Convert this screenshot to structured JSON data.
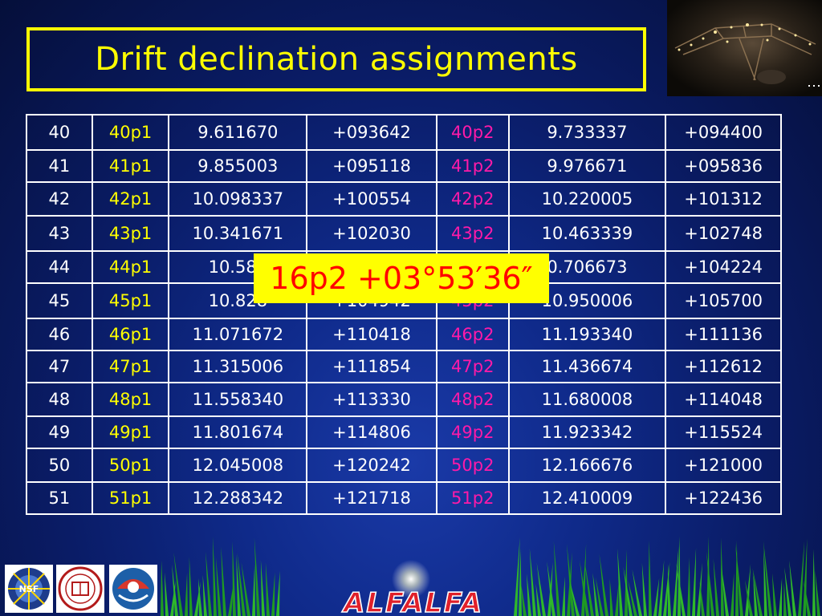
{
  "title": "Drift declination assignments",
  "popup": "16p2 +03°53′36″",
  "rows": [
    [
      "40",
      "40p1",
      "9.611670",
      "+093642",
      "40p2",
      "9.733337",
      "+094400"
    ],
    [
      "41",
      "41p1",
      "9.855003",
      "+095118",
      "41p2",
      "9.976671",
      "+095836"
    ],
    [
      "42",
      "42p1",
      "10.098337",
      "+100554",
      "42p2",
      "10.220005",
      "+101312"
    ],
    [
      "43",
      "43p1",
      "10.341671",
      "+102030",
      "43p2",
      "10.463339",
      "+102748"
    ],
    [
      "44",
      "44p1",
      "10.585",
      "",
      "",
      "0.706673",
      "+104224"
    ],
    [
      "45",
      "45p1",
      "10.828",
      "+104942",
      "45p2",
      "10.950006",
      "+105700"
    ],
    [
      "46",
      "46p1",
      "11.071672",
      "+110418",
      "46p2",
      "11.193340",
      "+111136"
    ],
    [
      "47",
      "47p1",
      "11.315006",
      "+111854",
      "47p2",
      "11.436674",
      "+112612"
    ],
    [
      "48",
      "48p1",
      "11.558340",
      "+113330",
      "48p2",
      "11.680008",
      "+114048"
    ],
    [
      "49",
      "49p1",
      "11.801674",
      "+114806",
      "49p2",
      "11.923342",
      "+115524"
    ],
    [
      "50",
      "50p1",
      "12.045008",
      "+120242",
      "50p2",
      "12.166676",
      "+121000"
    ],
    [
      "51",
      "51p1",
      "12.288342",
      "+121718",
      "51p2",
      "12.410009",
      "+122436"
    ]
  ],
  "logos": {
    "nsf": "NSF",
    "alfalfa": "ALFALFA"
  },
  "colors": {
    "title": "#ffff00",
    "p1": "#ffff00",
    "p2": "#ff1aa8",
    "popup_bg": "#ffff00",
    "popup_text": "#ff0000",
    "background": "#0f2a8a"
  }
}
